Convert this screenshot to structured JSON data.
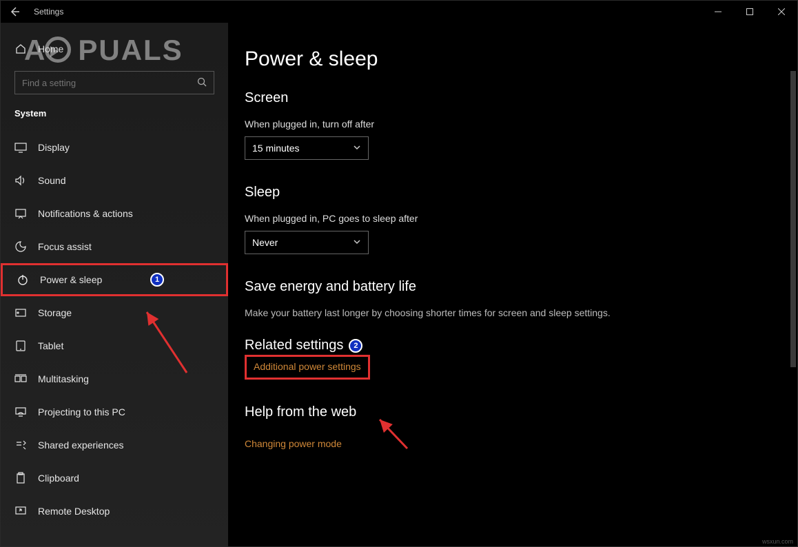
{
  "titlebar": {
    "title": "Settings"
  },
  "sidebar": {
    "home_label": "Home",
    "search_placeholder": "Find a setting",
    "category": "System",
    "items": [
      {
        "label": "Display"
      },
      {
        "label": "Sound"
      },
      {
        "label": "Notifications & actions"
      },
      {
        "label": "Focus assist"
      },
      {
        "label": "Power & sleep"
      },
      {
        "label": "Storage"
      },
      {
        "label": "Tablet"
      },
      {
        "label": "Multitasking"
      },
      {
        "label": "Projecting to this PC"
      },
      {
        "label": "Shared experiences"
      },
      {
        "label": "Clipboard"
      },
      {
        "label": "Remote Desktop"
      }
    ]
  },
  "main": {
    "page_title": "Power & sleep",
    "screen_heading": "Screen",
    "screen_label": "When plugged in, turn off after",
    "screen_value": "15 minutes",
    "sleep_heading": "Sleep",
    "sleep_label": "When plugged in, PC goes to sleep after",
    "sleep_value": "Never",
    "save_heading": "Save energy and battery life",
    "save_sub": "Make your battery last longer by choosing shorter times for screen and sleep settings.",
    "related_heading": "Related settings",
    "related_link": "Additional power settings",
    "help_heading": "Help from the web",
    "help_link": "Changing power mode"
  },
  "annotations": {
    "badge1": "1",
    "badge2": "2"
  },
  "watermark": {
    "text_left": "A",
    "text_right": "PUALS"
  },
  "source_note": "wsxun.com"
}
